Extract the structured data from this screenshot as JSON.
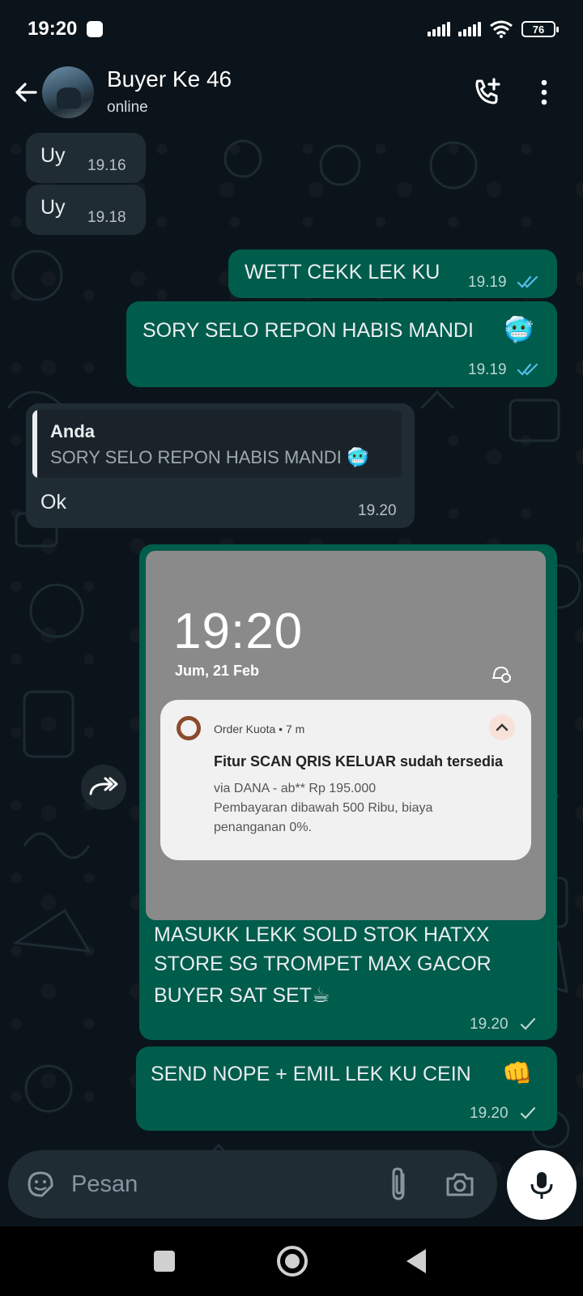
{
  "status_bar": {
    "time": "19:20",
    "battery": "76"
  },
  "header": {
    "contact_name": "Buyer Ke 46",
    "contact_status": "online"
  },
  "messages": [
    {
      "direction": "in",
      "text": "Uy",
      "time": "19.16"
    },
    {
      "direction": "in",
      "text": "Uy",
      "time": "19.18"
    },
    {
      "direction": "out",
      "text": "WETT CEKK LEK KU",
      "time": "19.19",
      "ticks": "double-blue"
    },
    {
      "direction": "out",
      "text": "SORY SELO REPON HABIS MANDI",
      "emoji": "🥶",
      "time": "19.19",
      "ticks": "double-blue"
    },
    {
      "direction": "in",
      "quote": {
        "author": "Anda",
        "text": "SORY SELO REPON HABIS MANDI",
        "emoji": "🥶"
      },
      "text": "Ok",
      "time": "19.20"
    },
    {
      "direction": "out",
      "image": {
        "lock_time": "19:20",
        "lock_date": "Jum, 21 Feb",
        "notification": {
          "app": "Order Kuota • 7 m",
          "title": "Fitur SCAN QRIS KELUAR sudah tersedia",
          "body_line1": "via DANA - ab** Rp 195.000",
          "body_line2": "Pembayaran dibawah 500 Ribu, biaya",
          "body_line3": "penanganan 0%."
        }
      },
      "text_line1": "MASUKK LEKK  SOLD STOK HATXX",
      "text_line2": "STORE SG TROMPET MAX GACOR",
      "text_line3": "BUYER SAT SET",
      "emoji": "☕",
      "time": "19.20",
      "ticks": "single-grey"
    },
    {
      "direction": "out",
      "text": "SEND NOPE + EMIL LEK KU CEIN",
      "emoji": "👊",
      "time": "19.20",
      "ticks": "single-grey"
    }
  ],
  "input": {
    "placeholder": "Pesan"
  },
  "colors": {
    "incoming": "#202c33",
    "outgoing": "#005c4b",
    "background": "#0b141a",
    "read_tick": "#53bdeb"
  },
  "icons": [
    "back-arrow-icon",
    "add-call-icon",
    "more-vert-icon",
    "forward-icon",
    "sticker-icon",
    "paperclip-icon",
    "camera-icon",
    "mic-icon"
  ]
}
